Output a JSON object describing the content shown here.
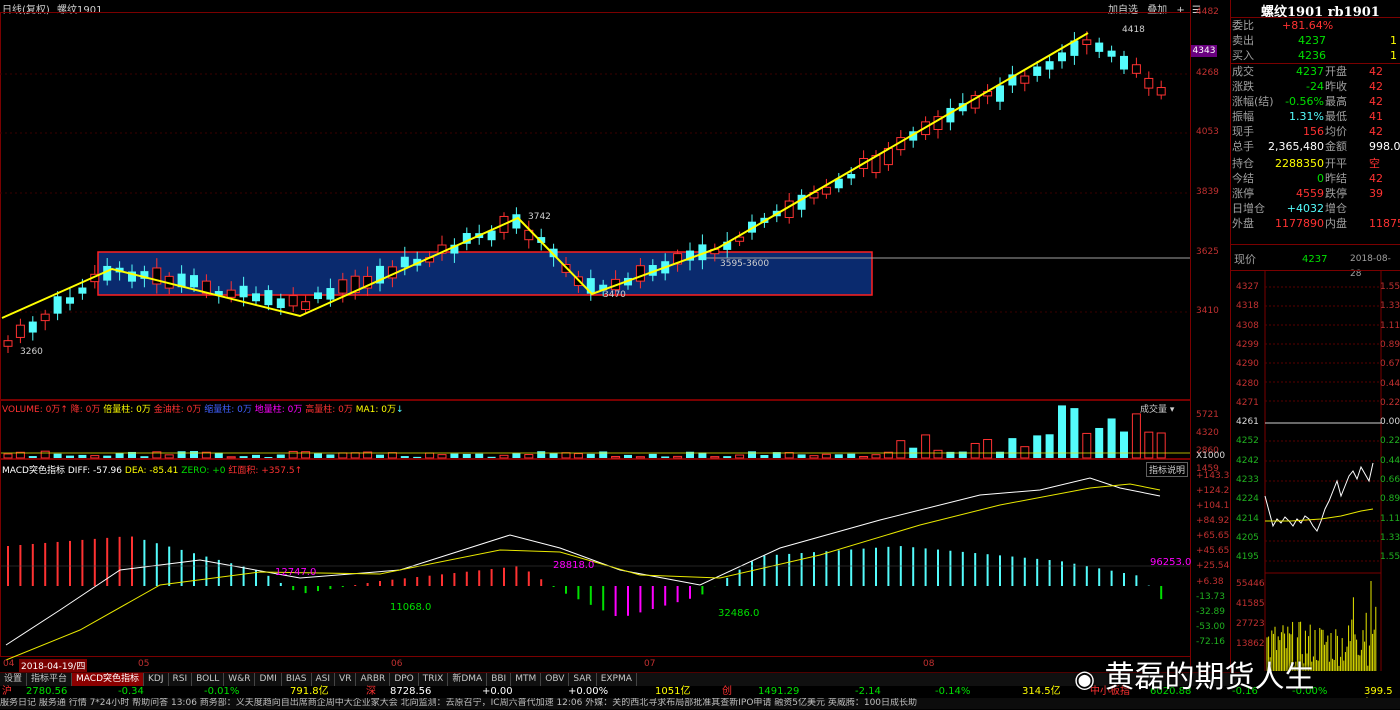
{
  "chart_header": {
    "period": "日线(复权)",
    "symbol": "螺纹1901"
  },
  "toolbar": {
    "add_watch": "加自选",
    "overlay": "叠加",
    "unlock": "+",
    "more": "☰"
  },
  "price_axis": {
    "labels": [
      "4482",
      "4343",
      "4268",
      "4053",
      "3839",
      "3625",
      "3410"
    ],
    "current": "4343"
  },
  "annotations": {
    "high_4418": "4418",
    "peak_3742": "3742",
    "low_3260": "3260",
    "low_3470": "3470",
    "zone": "3595-3600"
  },
  "volume_panel": {
    "title": "VOLUME: 0万",
    "items": [
      "降: 0万",
      "倍量柱: 0万",
      "金油柱: 0万",
      "缩量柱: 0万",
      "地量柱: 0万",
      "高量柱: 0万",
      "MA1: 0万"
    ],
    "axis": [
      "5721",
      "4320",
      "2860",
      "1459",
      "X1000"
    ],
    "dropdown": "成交量"
  },
  "macd_panel": {
    "title": "MACD突色指标",
    "diff": "DIFF: -57.96",
    "dea": "DEA: -85.41",
    "zero": "ZERO: +0",
    "red_area": "红面积: +357.5",
    "help_btn": "指标说明",
    "axis": [
      "+143.3",
      "+124.2",
      "+104.1",
      "+84.92",
      "+65.65",
      "+45.65",
      "+25.54",
      "+6.38",
      "-13.73",
      "-32.89",
      "-53.00",
      "-72.16"
    ],
    "area_labels": [
      "12747.0",
      "28818.0",
      "96253.0",
      "11068.0",
      "32486.0"
    ]
  },
  "date_axis": {
    "labels": [
      "04",
      "2018-04-19/四",
      "05",
      "06",
      "07",
      "08"
    ]
  },
  "tabs": [
    "设置",
    "指标平台",
    "MACD突色指标",
    "KDJ",
    "RSI",
    "BOLL",
    "W&R",
    "DMI",
    "BIAS",
    "ASI",
    "VR",
    "ARBR",
    "DPO",
    "TRIX",
    "新DMA",
    "BBI",
    "MTM",
    "OBV",
    "SAR",
    "EXPMA"
  ],
  "quotes_bar": [
    {
      "label": "沪",
      "value": "2780.56",
      "chg": "-0.34",
      "pct": "-0.01%",
      "amt": "791.8亿"
    },
    {
      "label": "深",
      "value": "8728.56",
      "chg": "+0.00",
      "pct": "+0.00%",
      "amt": "1051亿"
    },
    {
      "label": "创",
      "value": "1491.29",
      "chg": "-2.14",
      "pct": "-0.14%",
      "amt": "314.5亿"
    },
    {
      "label": "中小板指",
      "value": "6020.88",
      "chg": "-0.16",
      "pct": "-0.00%",
      "amt": "399.5亿"
    }
  ],
  "ticker": "服务日记  服务通  行情  7*24小时  帮助问答    13:06 商务部：义夫度趋向自出席商企周中大企业家大会     北向监测：去原召宁，IC周六普代加速     12:06 外媒：关的西北寻求布局部批准其查新IPO申请 融资5亿美元     英威腾：100日成长助",
  "right_panel": {
    "title": "螺纹1901 rb1901",
    "wei_bi_label": "委比",
    "wei_bi": "+81.64%",
    "sell_label": "卖出",
    "sell": "4237",
    "sell_vol": "1",
    "buy_label": "买入",
    "buy": "4236",
    "buy_vol": "1",
    "rows": [
      {
        "l1": "成交",
        "v1": "4237",
        "l2": "开盘",
        "v2": "42"
      },
      {
        "l1": "涨跌",
        "v1": "-24",
        "l2": "昨收",
        "v2": "42"
      },
      {
        "l1": "涨幅(结)",
        "v1": "-0.56%",
        "l2": "最高",
        "v2": "42"
      },
      {
        "l1": "振幅",
        "v1": "1.31%",
        "l2": "最低",
        "v2": "41"
      },
      {
        "l1": "现手",
        "v1": "156",
        "l2": "均价",
        "v2": "42"
      },
      {
        "l1": "总手",
        "v1": "2,365,480",
        "l2": "金额",
        "v2": "998.0"
      },
      {
        "l1": "持仓",
        "v1": "2288350",
        "l2": "开平",
        "v2": "空"
      },
      {
        "l1": "今结",
        "v1": "0",
        "l2": "昨结",
        "v2": "42"
      },
      {
        "l1": "涨停",
        "v1": "4559",
        "l2": "跌停",
        "v2": "39"
      },
      {
        "l1": "日增仓",
        "v1": "+4032",
        "l2": "增仓",
        "v2": ""
      },
      {
        "l1": "外盘",
        "v1": "1177890",
        "l2": "内盘",
        "v2": "11875"
      }
    ],
    "now_label": "现价",
    "now_price": "4237",
    "now_date": "2018-08-28",
    "tl_left": [
      "4327",
      "4318",
      "4308",
      "4299",
      "4290",
      "4280",
      "4271",
      "4261",
      "4252",
      "4242",
      "4233",
      "4224",
      "4214",
      "4205",
      "4195",
      "55446",
      "41585",
      "27723",
      "13862"
    ],
    "tl_right": [
      "1.55",
      "1.33",
      "1.11",
      "0.89",
      "0.67",
      "0.44",
      "0.22",
      "0.00",
      "0.22",
      "0.44",
      "0.66",
      "0.89",
      "1.11",
      "1.33",
      "1.55"
    ]
  },
  "watermark": "黄磊的期货人生"
}
